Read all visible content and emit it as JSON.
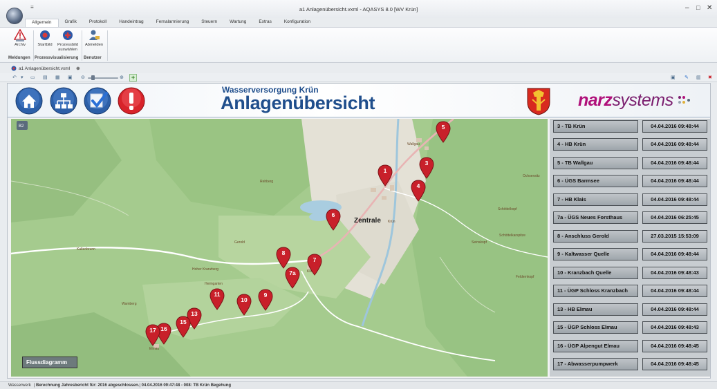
{
  "window": {
    "title": "a1 Anlagenübersicht.vxml - AQASYS 8.0 [WV Krün]"
  },
  "ribbon": {
    "tabs": [
      "Allgemein",
      "Grafik",
      "Protokoll",
      "Handeintrag",
      "Fernalarmierung",
      "Steuern",
      "Wartung",
      "Extras",
      "Konfiguration"
    ],
    "buttons": {
      "archiv": "Archiv",
      "startbild": "Startbild",
      "prozessbild_1": "Prozessbild",
      "prozessbild_2": "auswählen",
      "abmelden": "Abmelden"
    },
    "groups": {
      "meldungen": "Meldungen",
      "prozess": "Prozessvisualisierung",
      "benutzer": "Benutzer"
    }
  },
  "doc_tab": {
    "label": "a1 Anlagenübersicht.vxml"
  },
  "header": {
    "subtitle": "Wasserversorgung Krün",
    "title": "Anlagenübersicht",
    "brand_1": "narz",
    "brand_2": "systems"
  },
  "map": {
    "center_label": "Zentrale",
    "flow_button": "Flussdiagramm",
    "pins": [
      "1",
      "3",
      "4",
      "5",
      "6",
      "7",
      "7a",
      "8",
      "9",
      "10",
      "11",
      "13",
      "15",
      "16",
      "17"
    ],
    "places": {
      "p1": "Kaltenbrunn",
      "p2": "Gerold",
      "p3": "Wallgau",
      "p4": "Krün",
      "p5": "Klais",
      "p6": "Elmau",
      "p7": "Ochsensitz",
      "p8": "Schöttelkopf",
      "p9": "Seinskopf",
      "p10": "Schöttelkarspitze",
      "p11": "Feldernkopf",
      "p12": "Heimgarten",
      "p13": "Hoher Kranzberg",
      "p14": "Wamberg",
      "p15": "Rehberg"
    }
  },
  "stations": [
    {
      "name": "3 - TB Krün",
      "date": "04.04.2016 09:48:44"
    },
    {
      "name": "4 - HB Krün",
      "date": "04.04.2016 09:48:44"
    },
    {
      "name": "5 - TB Wallgau",
      "date": "04.04.2016 09:48:44"
    },
    {
      "name": "6 - ÜGS Barmsee",
      "date": "04.04.2016 09:48:44"
    },
    {
      "name": "7 - HB Klais",
      "date": "04.04.2016 09:48:44"
    },
    {
      "name": "7a - ÜGS Neues Forsthaus",
      "date": "04.04.2016 06:25:45"
    },
    {
      "name": "8 - Anschluss Gerold",
      "date": "27.03.2015 15:53:09"
    },
    {
      "name": "9 - Kaltwasser Quelle",
      "date": "04.04.2016 09:48:44"
    },
    {
      "name": "10 - Kranzbach Quelle",
      "date": "04.04.2016 09:48:43"
    },
    {
      "name": "11 - ÜGP Schloss Kranzbach",
      "date": "04.04.2016 09:48:44"
    },
    {
      "name": "13 - HB Elmau",
      "date": "04.04.2016 09:48:44"
    },
    {
      "name": "15 - ÜGP Schloss Elmau",
      "date": "04.04.2016 09:48:43"
    },
    {
      "name": "16 - ÜGP Alpengut Elmau",
      "date": "04.04.2016 09:48:45"
    },
    {
      "name": "17 - Abwasserpumpwerk",
      "date": "04.04.2016 09:48:45"
    }
  ],
  "status": {
    "s1": "Wasserwerk",
    "s2": "Berechnung Jahresbericht für: 2016 abgeschlossen.",
    "s3": "04.04.2016 09:47:48 - 008: TB Krün Begehung"
  },
  "colors": {
    "title_blue": "#1f4e8c",
    "pin_red": "#c8202a",
    "brand_magenta": "#b0107a"
  }
}
